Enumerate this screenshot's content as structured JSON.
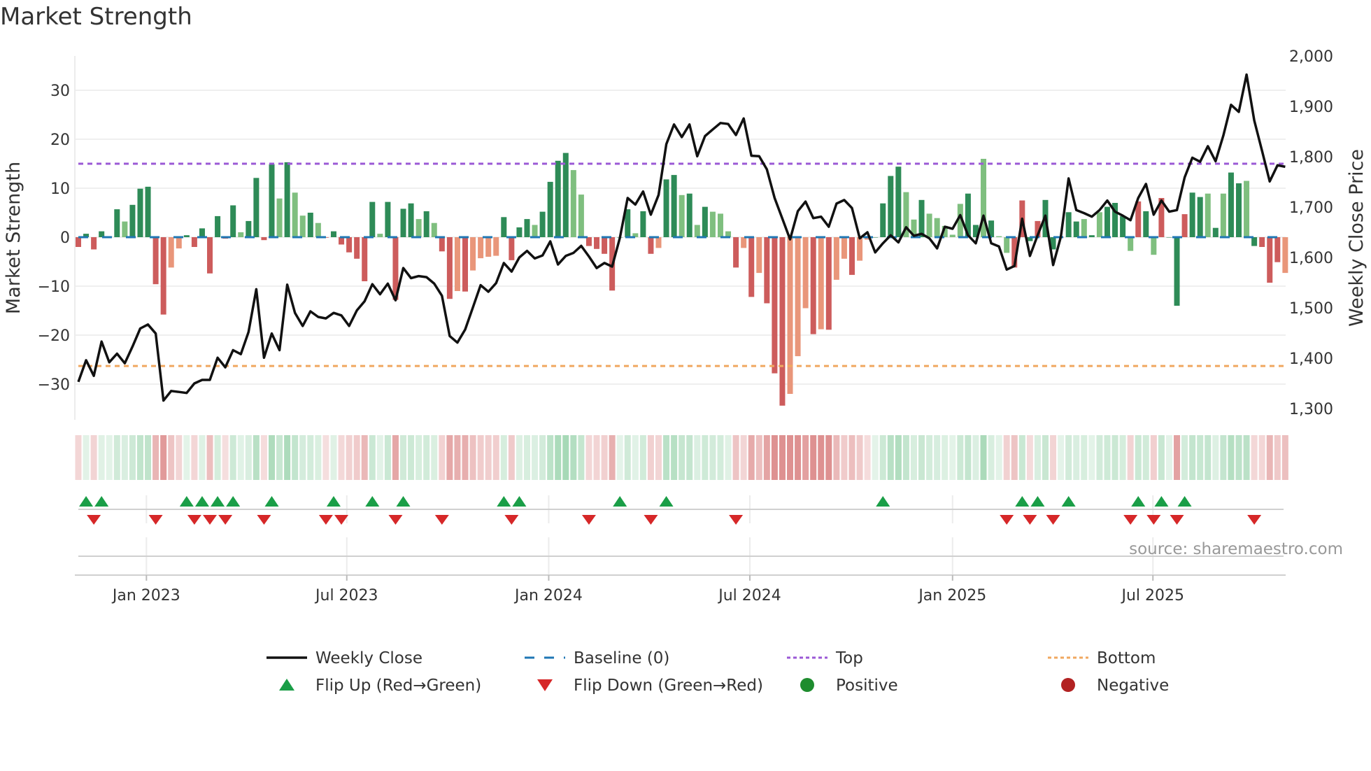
{
  "title": "Market Strength",
  "source": "source: sharemaestro.com",
  "colors": {
    "strong_green": "#2e8b57",
    "light_green": "#7fbf7f",
    "strong_red": "#cd5c5c",
    "light_red": "#e9967a",
    "top": "#9b59d6",
    "bottom": "#f0a860",
    "baseline": "#1f77b4",
    "flip_up": "#1a9e47",
    "flip_down": "#d62728",
    "positive": "#1e8c2e",
    "negative": "#b22222",
    "line": "#111111"
  },
  "legend": [
    {
      "key": "weekly_close",
      "label": "Weekly Close"
    },
    {
      "key": "baseline",
      "label": "Baseline (0)"
    },
    {
      "key": "top",
      "label": "Top"
    },
    {
      "key": "bottom",
      "label": "Bottom"
    },
    {
      "key": "flip_up",
      "label": "Flip Up (Red→Green)"
    },
    {
      "key": "flip_down",
      "label": "Flip Down (Green→Red)"
    },
    {
      "key": "positive",
      "label": "Positive"
    },
    {
      "key": "negative",
      "label": "Negative"
    }
  ],
  "chart_data": {
    "type": "bar",
    "title": "Market Strength",
    "xlabel": "",
    "ylabel": "Market Strength",
    "y2label": "Weekly Close Price",
    "ylim": [
      -37,
      37
    ],
    "y2lim": [
      1260,
      2030
    ],
    "yticks": [
      30,
      20,
      10,
      0,
      -10,
      -20,
      -30
    ],
    "ytick_labels": [
      "30",
      "20",
      "10",
      "0",
      "−10",
      "−20",
      "−30"
    ],
    "y2ticks": [
      2000,
      1900,
      1800,
      1700,
      1600,
      1500,
      1400,
      1300
    ],
    "y2tick_labels": [
      "2,000",
      "1,900",
      "1,800",
      "1,700",
      "1,600",
      "1,500",
      "1,400",
      "1,300"
    ],
    "x_unit": "week index (weekly bars from early Nov 2022)",
    "xticks": [
      {
        "x": 8.8,
        "label": "Jan 2023"
      },
      {
        "x": 34.7,
        "label": "Jul 2023"
      },
      {
        "x": 60.8,
        "label": "Jan 2024"
      },
      {
        "x": 86.8,
        "label": "Jul 2024"
      },
      {
        "x": 113.0,
        "label": "Jan 2025"
      },
      {
        "x": 138.9,
        "label": "Jul 2025"
      }
    ],
    "top_level": 15,
    "bottom_level": -26.3,
    "baseline": 0,
    "strength": [
      -2,
      0.7,
      -2.5,
      1.2,
      0.2,
      5.7,
      3.2,
      6.6,
      9.9,
      10.3,
      -9.6,
      -15.8,
      -6.2,
      -2.3,
      0.4,
      -2,
      1.8,
      -7.4,
      4.3,
      -0.3,
      6.5,
      1,
      3.3,
      12.1,
      -0.6,
      14.9,
      7.9,
      15.3,
      9.1,
      4.4,
      5,
      2.9,
      -0.1,
      1.2,
      -1.5,
      -3.1,
      -4.4,
      -9,
      7.2,
      0.7,
      7.2,
      -12.8,
      5.8,
      6.9,
      3.7,
      5.3,
      2.9,
      -2.9,
      -12.6,
      -11,
      -11.1,
      -6.8,
      -4.3,
      -4,
      -3.8,
      4.1,
      -4.7,
      2,
      3.7,
      2.5,
      5.2,
      11.3,
      15.6,
      17.2,
      13.7,
      8.7,
      -1.8,
      -2.4,
      -3.4,
      -10.9,
      0,
      5.7,
      0.8,
      5.3,
      -3.4,
      -2.2,
      11.8,
      12.7,
      8.6,
      8.9,
      2.5,
      6.2,
      5.2,
      4.8,
      1.2,
      -6.2,
      -2.2,
      -12.2,
      -7.3,
      -13.5,
      -27.8,
      -34.4,
      -32,
      -24.3,
      -14.5,
      -19.8,
      -18.8,
      -18.9,
      -8.7,
      -4.4,
      -7.7,
      -4.8,
      -0.5,
      0,
      6.9,
      12.5,
      14.4,
      9.2,
      3.6,
      7.6,
      4.8,
      3.9,
      2.3,
      0.5,
      6.8,
      8.9,
      2.5,
      16,
      3.4,
      0.2,
      -3.2,
      -6.2,
      7.5,
      -0.8,
      3.3,
      7.6,
      -2.5,
      0,
      5.1,
      3.2,
      3.7,
      0.4,
      5.1,
      6.2,
      7,
      4.3,
      -2.8,
      7.3,
      5.3,
      -3.6,
      8,
      0,
      -14,
      4.7,
      9.1,
      8.2,
      8.9,
      1.9,
      8.9,
      13.2,
      11,
      11.5,
      -1.8,
      -2,
      -9.3,
      -5.1,
      -7.3
    ],
    "shade": "RGRGgGgGGGRRrrGRGRGRGgGGRGgGggGgRGRRRRGgGRGGgGgRRrRrrrrGRGGgGGGGggRRRRGGgGRrGGgGgGgggRrRrRRRrrrRrRrrRrrGGGGggGgggggGGgGggRRGRGGRGGgGgGGGgRGgRGGRGGgGgGGgGRRRrR",
    "weekly_close": [
      1353,
      1396,
      1365,
      1433,
      1392,
      1409,
      1390,
      1423,
      1459,
      1467,
      1449,
      1316,
      1335,
      1333,
      1331,
      1350,
      1357,
      1357,
      1401,
      1382,
      1416,
      1408,
      1452,
      1537,
      1401,
      1449,
      1416,
      1546,
      1490,
      1464,
      1493,
      1482,
      1479,
      1490,
      1485,
      1464,
      1495,
      1513,
      1547,
      1527,
      1548,
      1515,
      1579,
      1559,
      1563,
      1561,
      1548,
      1524,
      1444,
      1431,
      1457,
      1501,
      1545,
      1532,
      1549,
      1589,
      1572,
      1600,
      1613,
      1598,
      1604,
      1632,
      1586,
      1603,
      1609,
      1623,
      1602,
      1579,
      1589,
      1582,
      1639,
      1718,
      1705,
      1731,
      1685,
      1724,
      1825,
      1864,
      1839,
      1864,
      1801,
      1841,
      1854,
      1867,
      1865,
      1843,
      1876,
      1802,
      1801,
      1775,
      1718,
      1677,
      1636,
      1692,
      1711,
      1678,
      1681,
      1661,
      1707,
      1714,
      1698,
      1638,
      1650,
      1610,
      1628,
      1644,
      1630,
      1660,
      1643,
      1647,
      1638,
      1618,
      1661,
      1657,
      1684,
      1644,
      1628,
      1683,
      1628,
      1622,
      1576,
      1583,
      1677,
      1603,
      1644,
      1683,
      1585,
      1641,
      1757,
      1694,
      1688,
      1681,
      1694,
      1713,
      1691,
      1683,
      1674,
      1718,
      1746,
      1685,
      1713,
      1691,
      1694,
      1759,
      1798,
      1790,
      1821,
      1791,
      1842,
      1903,
      1889,
      1963,
      1872,
      1812,
      1751,
      1783,
      1780
    ],
    "flip_up_weeks": [
      1,
      3,
      14,
      16,
      18,
      20,
      25,
      33,
      38,
      42,
      55,
      57,
      70,
      76,
      104,
      122,
      124,
      128,
      137,
      140,
      143
    ],
    "flip_down_weeks": [
      2,
      10,
      15,
      17,
      19,
      24,
      32,
      34,
      41,
      47,
      56,
      66,
      74,
      85,
      120,
      123,
      126,
      136,
      139,
      142,
      152
    ],
    "grid": true,
    "legend_position": "bottom"
  }
}
